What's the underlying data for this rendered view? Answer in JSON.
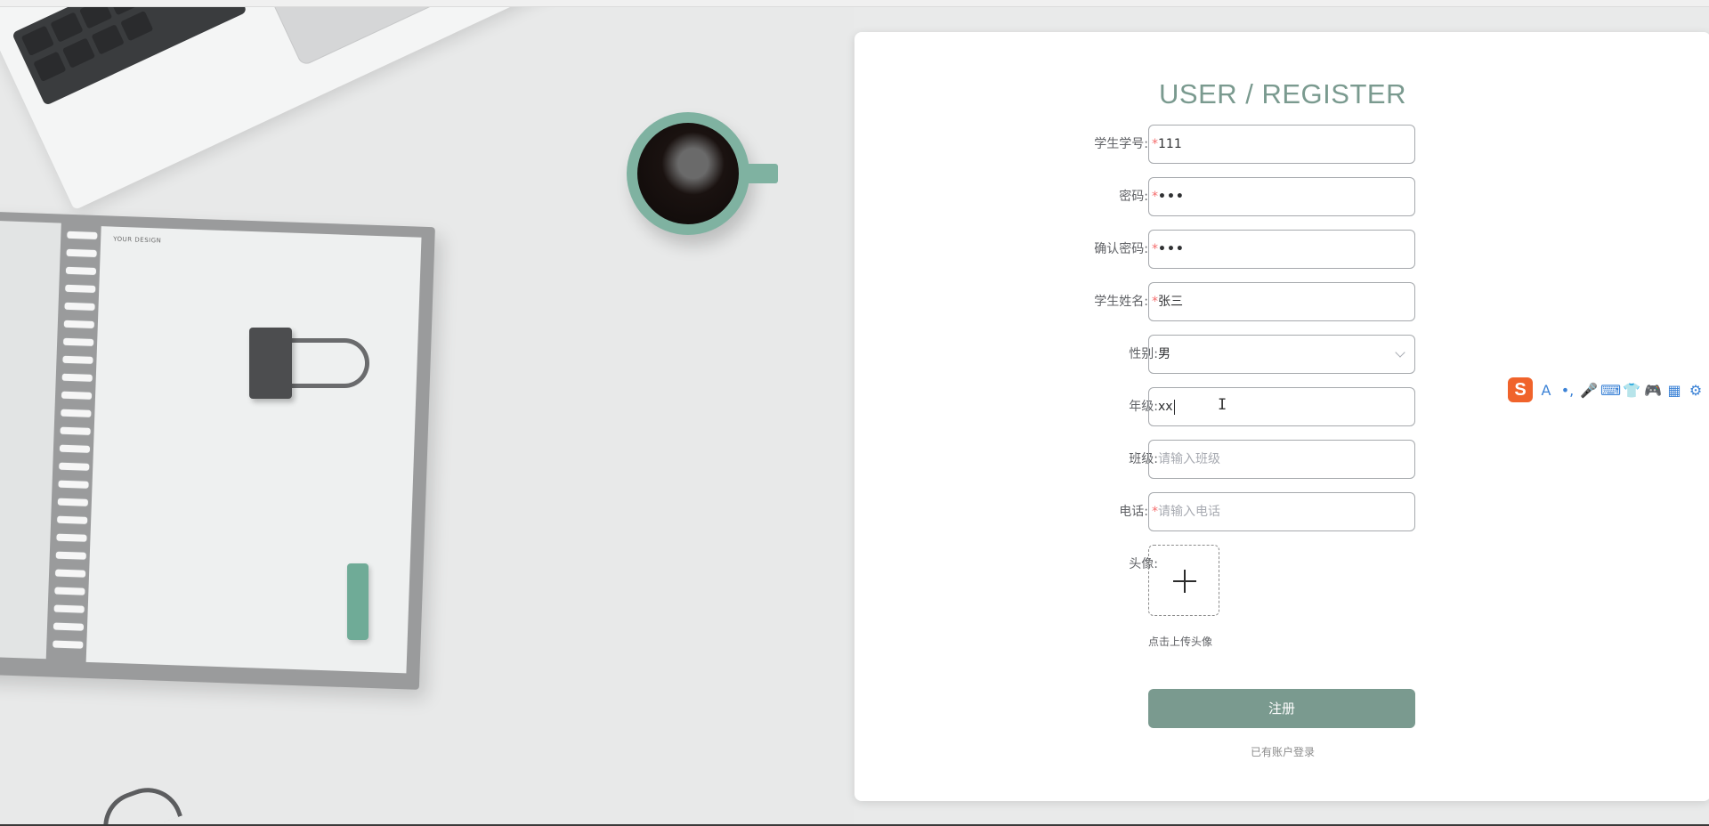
{
  "form": {
    "title": "USER / REGISTER",
    "fields": [
      {
        "label": "学生学号:",
        "required": true,
        "value": "111",
        "placeholder": ""
      },
      {
        "label": "密码:",
        "required": true,
        "value": "•••",
        "placeholder": ""
      },
      {
        "label": "确认密码:",
        "required": true,
        "value": "•••",
        "placeholder": ""
      },
      {
        "label": "学生姓名:",
        "required": true,
        "value": "张三",
        "placeholder": ""
      },
      {
        "label": "性别:",
        "required": false,
        "value": "男",
        "placeholder": ""
      },
      {
        "label": "年级:",
        "required": false,
        "value": "xx",
        "placeholder": ""
      },
      {
        "label": "班级:",
        "required": false,
        "value": "",
        "placeholder": "请输入班级"
      },
      {
        "label": "电话:",
        "required": true,
        "value": "",
        "placeholder": "请输入电话"
      }
    ],
    "avatar": {
      "label": "头像:",
      "hint": "点击上传头像"
    },
    "required_mark": "*",
    "submit_label": "注册",
    "login_link": "已有账户登录"
  },
  "background": {
    "notebook_brand": "YOUR DESIGN"
  },
  "ime_toolbar": {
    "logo": "S",
    "items": [
      "A",
      "•,",
      "🎤",
      "⌨",
      "👕",
      "🎮",
      "▦",
      "⚙"
    ]
  },
  "colors": {
    "accent": "#7a9a8f",
    "required": "#f56c6c",
    "ime_logo": "#f0632b",
    "ime_icons": "#3b82d6"
  }
}
